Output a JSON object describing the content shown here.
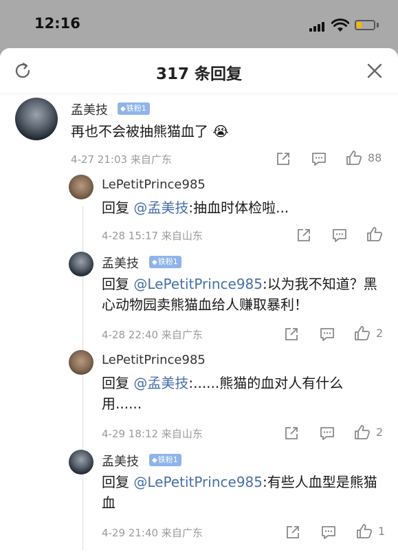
{
  "status": {
    "time": "12:16",
    "battery_color": "#f5b800"
  },
  "header": {
    "title": "317 条回复",
    "refresh_icon": "refresh-icon",
    "close_icon": "close-icon"
  },
  "colors": {
    "mention": "#476fa8",
    "badge": "#8fb4ea",
    "meta": "#9a9a9a"
  },
  "main_comment": {
    "author": "孟美技",
    "badge": "铁粉1",
    "text": "再也不会被抽熊猫血了",
    "emoji": "😭",
    "date": "4-27 21:03",
    "location": "来自广东",
    "likes": "88"
  },
  "replies": [
    {
      "author": "LePetitPrince985",
      "badge": "",
      "reply_prefix": "回复",
      "mention": "@孟美技",
      "text": ":抽血时体检啦...",
      "date": "4-28 15:17",
      "location": "来自山东",
      "likes": ""
    },
    {
      "author": "孟美技",
      "badge": "铁粉1",
      "reply_prefix": "回复",
      "mention": "@LePetitPrince985",
      "text": ":以为我不知道？黑心动物园卖熊猫血给人赚取暴利！",
      "date": "4-28 22:40",
      "location": "来自广东",
      "likes": "2"
    },
    {
      "author": "LePetitPrince985",
      "badge": "",
      "reply_prefix": "回复",
      "mention": "@孟美技",
      "text": ":......熊猫的血对人有什么用......",
      "date": "4-29 18:12",
      "location": "来自山东",
      "likes": "2"
    },
    {
      "author": "孟美技",
      "badge": "铁粉1",
      "reply_prefix": "回复",
      "mention": "@LePetitPrince985",
      "text": ":有些人血型是熊猫血",
      "date": "4-29 21:40",
      "location": "来自广东",
      "likes": "1"
    }
  ]
}
